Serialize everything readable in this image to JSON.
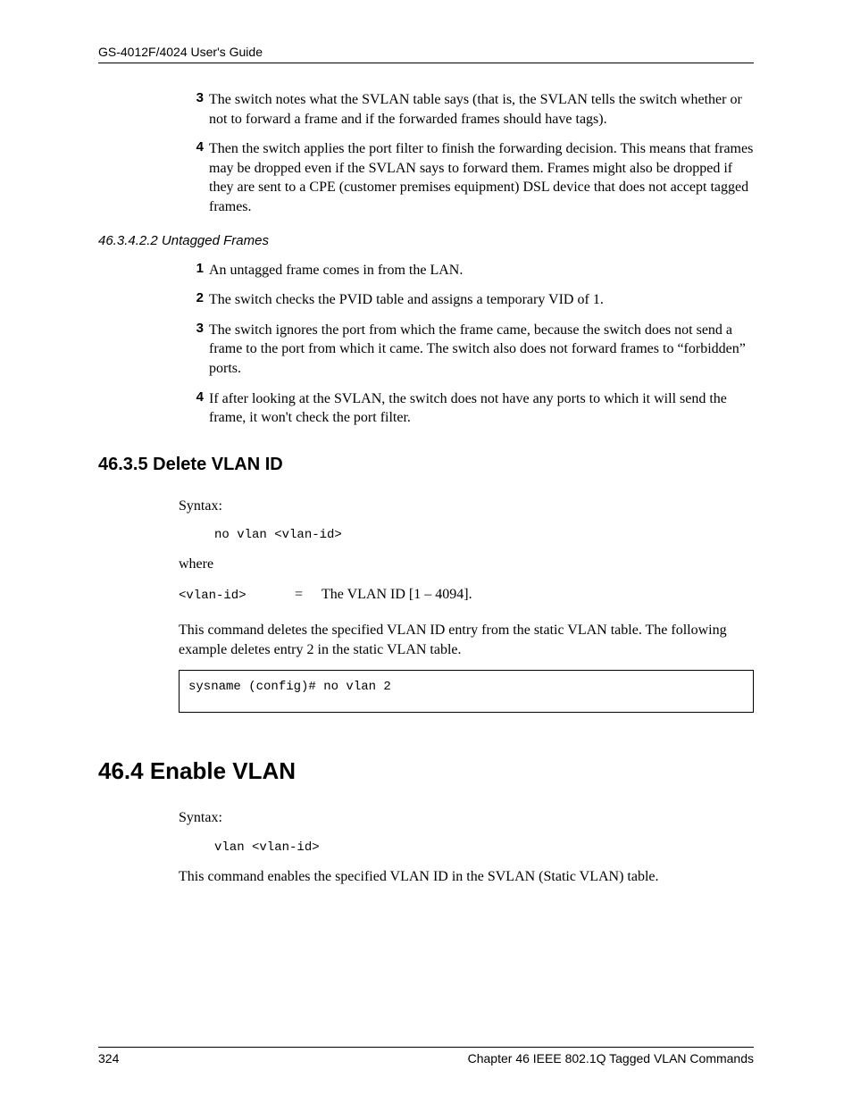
{
  "header": "GS-4012F/4024 User's Guide",
  "top_list": [
    {
      "num": "3",
      "text": "The switch notes what the SVLAN table says (that is, the SVLAN tells the switch whether or not to forward a frame and if the forwarded frames should have tags)."
    },
    {
      "num": "4",
      "text": "Then the switch applies the port filter to finish the forwarding decision. This means that frames may be dropped even if the SVLAN says to forward them. Frames might also be dropped if they are sent to a CPE (customer premises equipment) DSL device that does not accept tagged frames."
    }
  ],
  "sub_sub_heading": "46.3.4.2.2  Untagged Frames",
  "untagged_list": [
    {
      "num": "1",
      "text": "An untagged frame comes in from the LAN."
    },
    {
      "num": "2",
      "text": "The switch checks the PVID table and assigns a temporary VID of 1."
    },
    {
      "num": "3",
      "text": "The switch ignores the port from which the frame came, because the switch does not send a frame to the port from which it came. The switch also does not forward frames to “forbidden” ports."
    },
    {
      "num": "4",
      "text": "If after looking at the SVLAN, the switch does not have any ports to which it will send the frame, it won't check the port filter."
    }
  ],
  "section_delete": {
    "heading": "46.3.5  Delete VLAN ID",
    "syntax_label": "Syntax:",
    "syntax_code": "no vlan <vlan-id>",
    "where_label": "where",
    "param_name": "<vlan-id>",
    "param_eq": "=",
    "param_desc": "The VLAN ID [1 – 4094].",
    "desc": "This command deletes the specified VLAN ID entry from the static VLAN table. The following example deletes entry 2 in the static VLAN table.",
    "example": "sysname (config)# no vlan 2"
  },
  "section_enable": {
    "heading": "46.4  Enable VLAN",
    "syntax_label": "Syntax:",
    "syntax_code": "vlan <vlan-id>",
    "desc": "This command enables the specified VLAN ID in the SVLAN (Static VLAN) table."
  },
  "footer": {
    "page_num": "324",
    "chapter": "Chapter 46 IEEE 802.1Q Tagged VLAN Commands"
  }
}
